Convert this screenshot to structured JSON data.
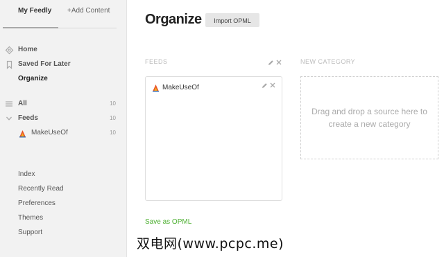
{
  "sidebar": {
    "tabs": {
      "my_feedly": "My Feedly",
      "add_content": "+Add Content"
    },
    "nav": {
      "home": "Home",
      "saved": "Saved For Later",
      "organize": "Organize",
      "all": {
        "label": "All",
        "count": "10"
      },
      "feeds": {
        "label": "Feeds",
        "count": "10"
      },
      "makeuseof": {
        "label": "MakeUseOf",
        "count": "10"
      }
    },
    "footer": {
      "index": "Index",
      "recently_read": "Recently Read",
      "preferences": "Preferences",
      "themes": "Themes",
      "support": "Support"
    }
  },
  "main": {
    "title": "Organize",
    "import_button": "Import OPML",
    "feeds_section": {
      "label": "FEEDS",
      "items": [
        {
          "name": "MakeUseOf"
        }
      ]
    },
    "new_category": {
      "label": "NEW CATEGORY",
      "hint": "Drag and drop a source here to create a new category"
    },
    "save_link": "Save as OPML"
  },
  "watermark": "双电网(www.pcpc.me)",
  "colors": {
    "accent_green": "#4caf30",
    "feed_icon_orange": "#e8552a"
  }
}
